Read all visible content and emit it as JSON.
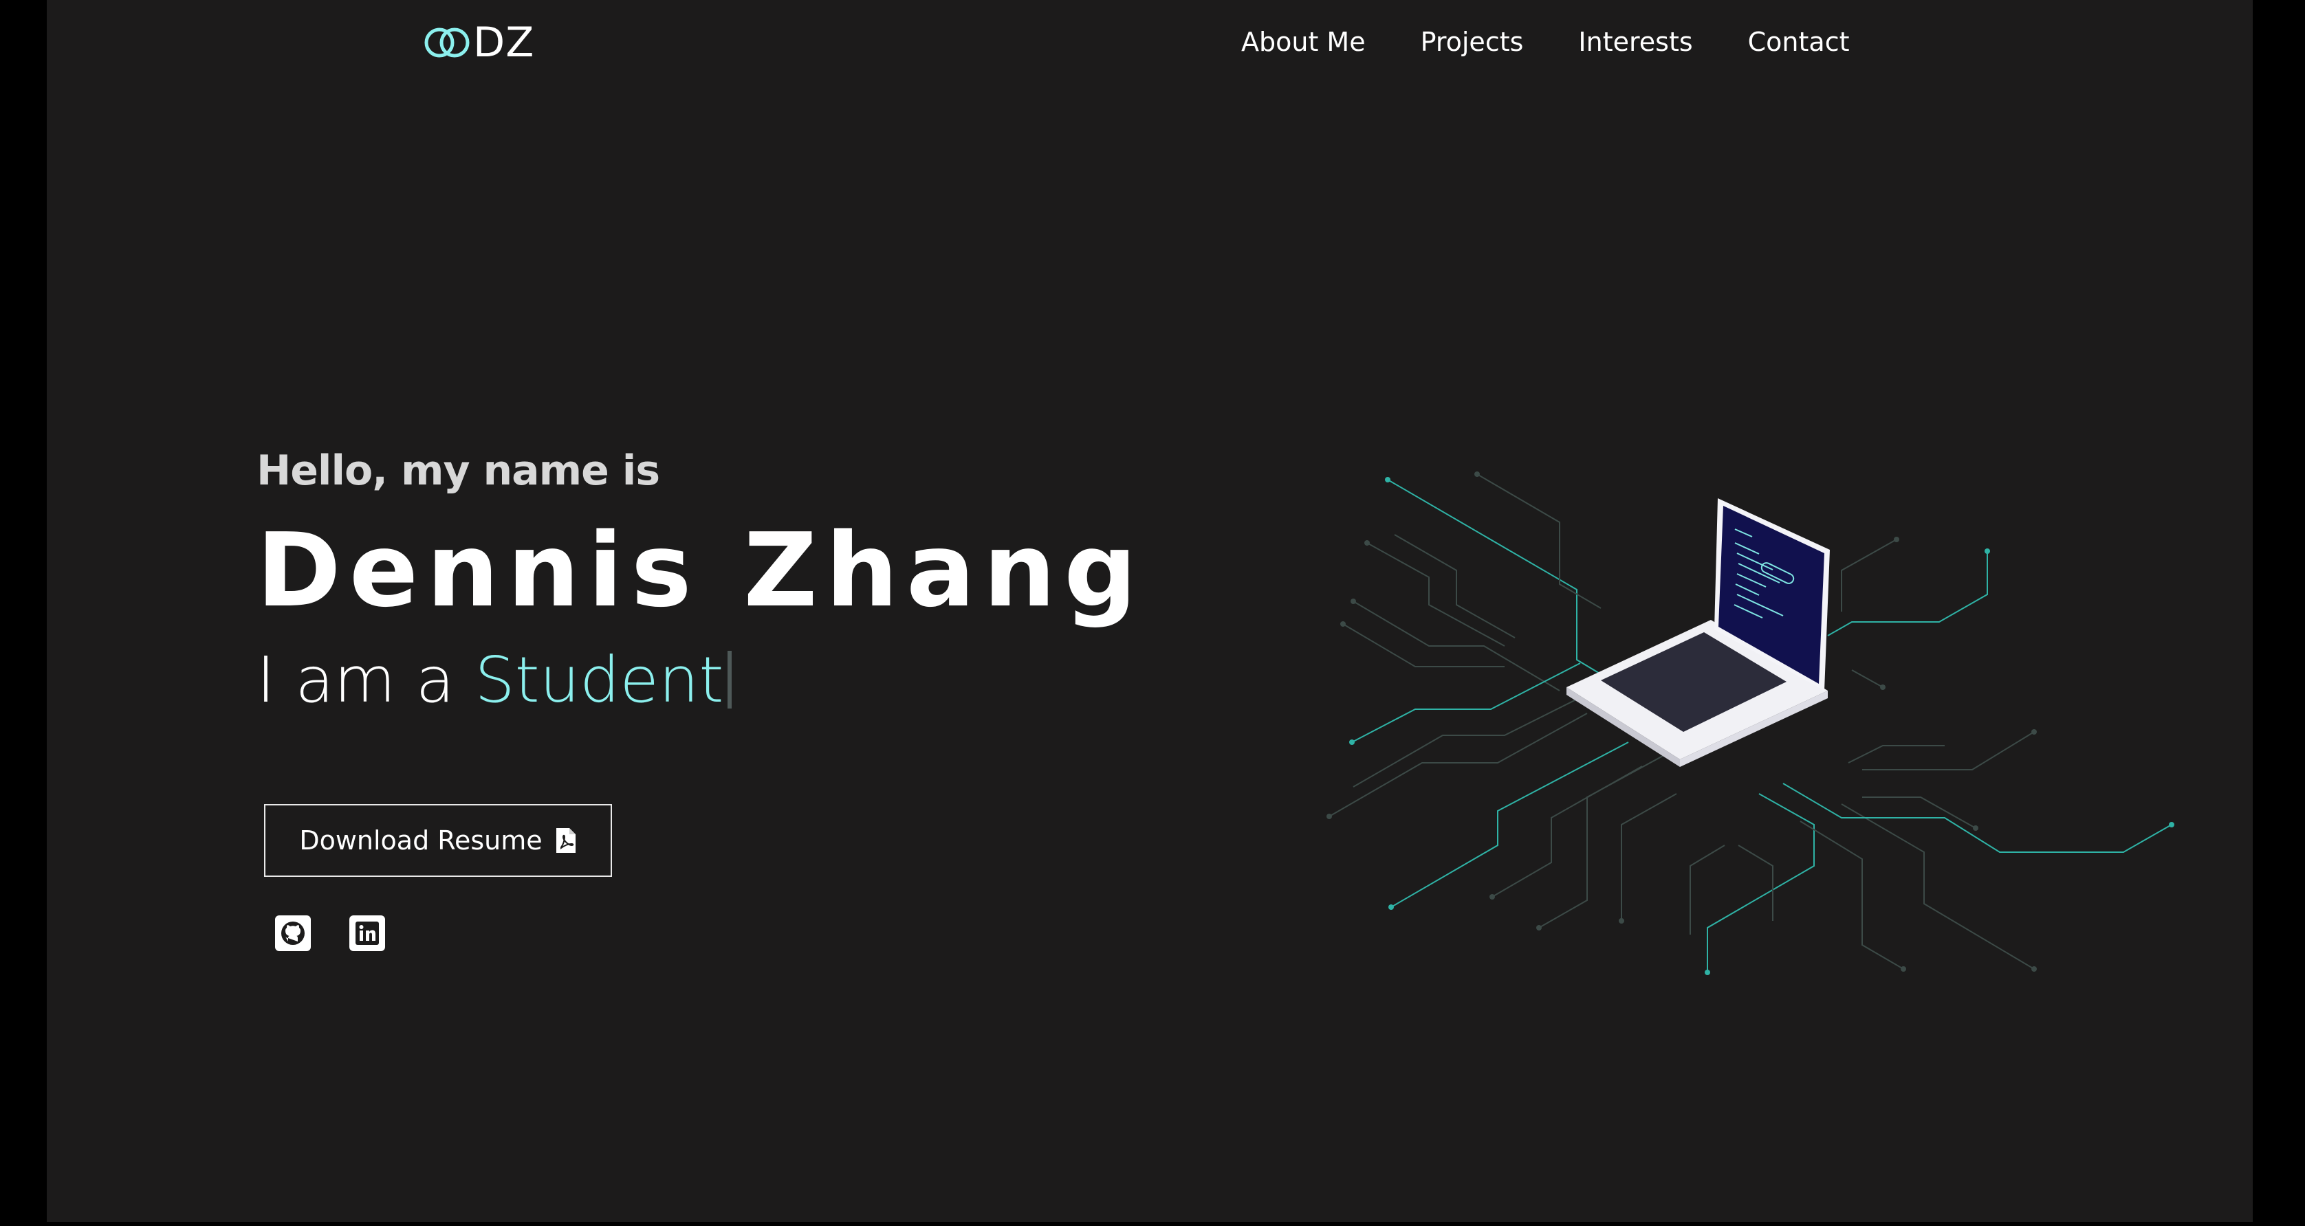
{
  "brand": {
    "logo_text": "DZ",
    "accent_color": "#8cf0ee",
    "background_color": "#1c1b1b"
  },
  "nav": {
    "links": [
      {
        "label": "About Me"
      },
      {
        "label": "Projects"
      },
      {
        "label": "Interests"
      },
      {
        "label": "Contact"
      }
    ]
  },
  "hero": {
    "greeting": "Hello, my name is",
    "name": "Dennis Zhang",
    "role_prefix": "I am a",
    "role_word": "Student",
    "resume_button_label": "Download Resume",
    "resume_icon": "file-pdf-icon",
    "socials": [
      {
        "icon": "github-icon"
      },
      {
        "icon": "linkedin-icon"
      }
    ],
    "illustration": "laptop-circuit-illustration"
  }
}
